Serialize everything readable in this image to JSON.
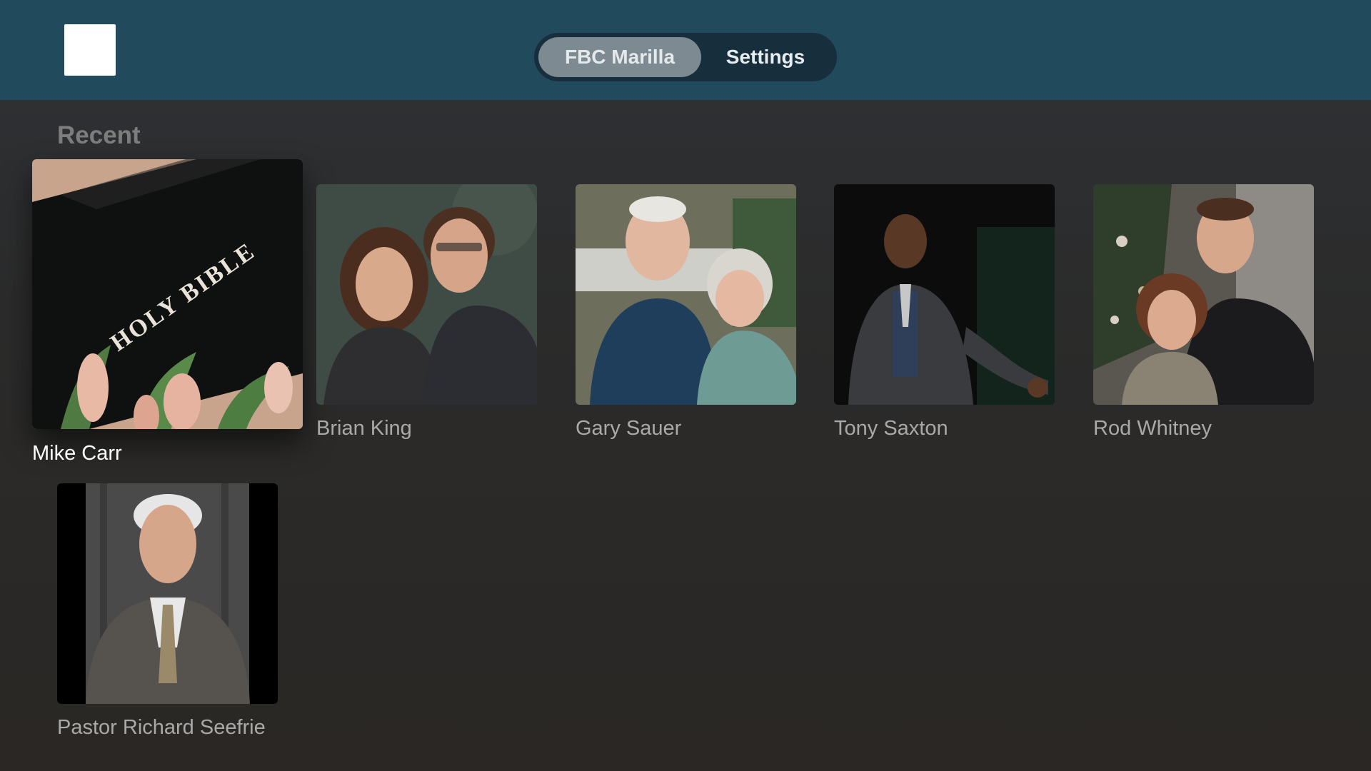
{
  "header": {
    "logo_icon": "app-logo-icon",
    "tabs": [
      {
        "label": "FBC Marilla",
        "active": true
      },
      {
        "label": "Settings",
        "active": false
      }
    ],
    "background_color": "#214a5d"
  },
  "main": {
    "section_title": "Recent",
    "items": [
      {
        "name": "Mike Carr",
        "image": "holy-bible-tulips-image",
        "focused": true
      },
      {
        "name": "Brian King",
        "image": "couple-portrait-image",
        "focused": false
      },
      {
        "name": "Gary Sauer",
        "image": "couple-porch-portrait-image",
        "focused": false
      },
      {
        "name": "Tony Saxton",
        "image": "singer-on-stage-image",
        "focused": false
      },
      {
        "name": "Rod Whitney",
        "image": "couple-christmas-tree-image",
        "focused": false
      },
      {
        "name": "Pastor Richard Seefrie",
        "image": "pastor-portrait-image",
        "focused": false
      }
    ]
  }
}
